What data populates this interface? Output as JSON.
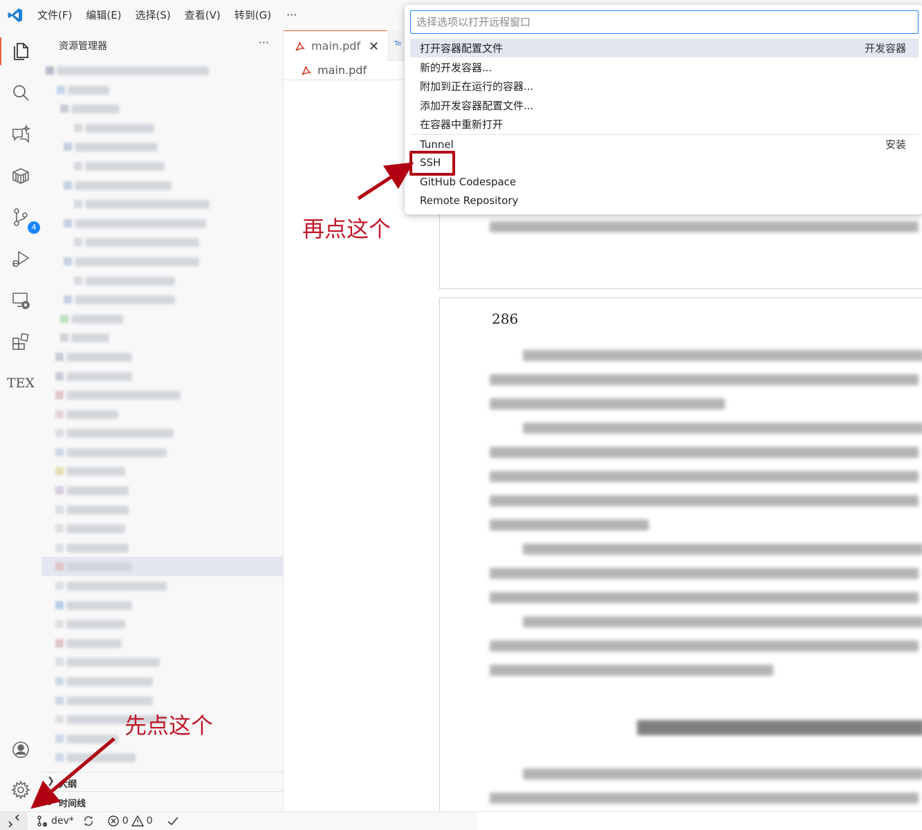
{
  "menu": {
    "items": [
      "文件(F)",
      "编辑(E)",
      "选择(S)",
      "查看(V)",
      "转到(G)"
    ],
    "more": "···"
  },
  "activity": {
    "scm_badge": "4",
    "tex_label": "TEX"
  },
  "sidebar": {
    "title": "资源管理器",
    "more": "···",
    "outline_label": "大纲",
    "timeline_label": "时间线"
  },
  "editor": {
    "tab_label": "main.pdf",
    "tab_close": "✕",
    "second_tab": "Te",
    "breadcrumb_label": "main.pdf",
    "page_number": "286"
  },
  "quickpick": {
    "placeholder": "选择选项以打开远程窗口",
    "items": [
      {
        "label": "打开容器配置文件",
        "group": "开发容器"
      },
      {
        "label": "新的开发容器..."
      },
      {
        "label": "附加到正在运行的容器..."
      },
      {
        "label": "添加开发容器配置文件..."
      },
      {
        "label": "在容器中重新打开"
      },
      {
        "label": "Tunnel",
        "group": "安装"
      },
      {
        "label": "SSH"
      },
      {
        "label": "GitHub Codespace"
      },
      {
        "label": "Remote Repository"
      }
    ]
  },
  "annotations": {
    "second": "再点这个",
    "first": "先点这个"
  },
  "status": {
    "branch": "dev*",
    "errors": "0",
    "warnings": "0"
  },
  "colors": {
    "accent": "#1a85ff",
    "annotation_red": "#c0182a",
    "tab_active_border": "#e8613a"
  }
}
